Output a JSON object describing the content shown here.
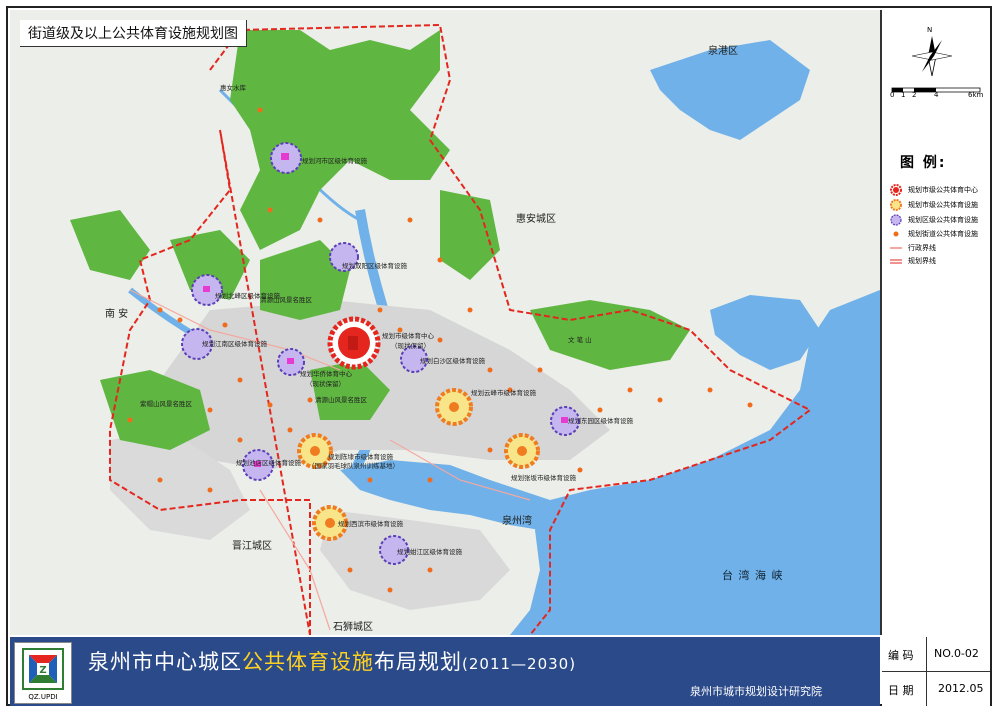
{
  "map_title": "街道级及以上公共体育设施规划图",
  "main_title": {
    "prefix": "泉州市中心城区",
    "highlight": "公共体育设施",
    "suffix": "布局规划",
    "years": "(2011—2030)"
  },
  "institute": "泉州市城市规划设计研究院",
  "logo_text": "QZ.UPDI",
  "info": {
    "code_label": "编 码",
    "code_value": "NO.0-02",
    "date_label": "日 期",
    "date_value": "2012.05"
  },
  "north": "N",
  "scale": {
    "ticks": [
      "0",
      "1",
      "2",
      "4",
      "6km"
    ]
  },
  "legend": {
    "title": "图 例:",
    "items": [
      {
        "label": "规划市级公共体育中心",
        "symbol": "city-center"
      },
      {
        "label": "规划市级公共体育设施",
        "symbol": "city-facility"
      },
      {
        "label": "规划区级公共体育设施",
        "symbol": "district-facility"
      },
      {
        "label": "规划街道公共体育设施",
        "symbol": "street-facility"
      },
      {
        "label": "行政界线",
        "symbol": "admin-line"
      },
      {
        "label": "规划界线",
        "symbol": "plan-line"
      }
    ]
  },
  "colors": {
    "forest": "#5fb641",
    "sea": "#6fb1e8",
    "urban": "#d9d9d9",
    "boundary": "#e4261e",
    "city_facility": "#ef7c20",
    "district_facility": "#8a7ad8",
    "street_facility": "#f06b1c",
    "title_bar": "#2b4a8a",
    "title_highlight": "#ffd21f"
  },
  "areas": {
    "quangang": "泉港区",
    "huian": "惠安城区",
    "nan": "南 安",
    "jinjiang": "晋江城区",
    "shishi": "石狮城区",
    "sea": "台 湾 海 峡",
    "bay": "泉州湾",
    "mountain": "文 笔 山"
  },
  "facilities": {
    "center": "规划市级体育中心",
    "center_sub": "（现状保留）",
    "luojiang": "规划河市区级体育设施",
    "shuangyang": "规划双阳区级体育设施",
    "beifeng": "规划北峰区级体育设施",
    "jiangnan": "规划江南区级体育设施",
    "huaqiao": "规划华侨体育中心",
    "huaqiao_sub": "（现状保留）",
    "baisha": "规划白沙区级体育设施",
    "yunfeng": "规划云峰市级体育设施",
    "dongyuan": "规划东园区级体育设施",
    "chendai": "规划陈埭市级体育设施",
    "chendai_sub": "（国家羽毛球队泉州训练基地）",
    "chijiang": "规划池店区级体育设施",
    "xiamei": "规划张坂市级体育设施",
    "xibin": "规划西滨市级体育设施",
    "fujiang": "规划蚶江区级体育设施",
    "ditie": "清源山风景名胜区",
    "ziyun": "紫帽山风景名胜区",
    "tongfo": "清源山风景名胜区",
    "huian_note": "惠女水库"
  }
}
